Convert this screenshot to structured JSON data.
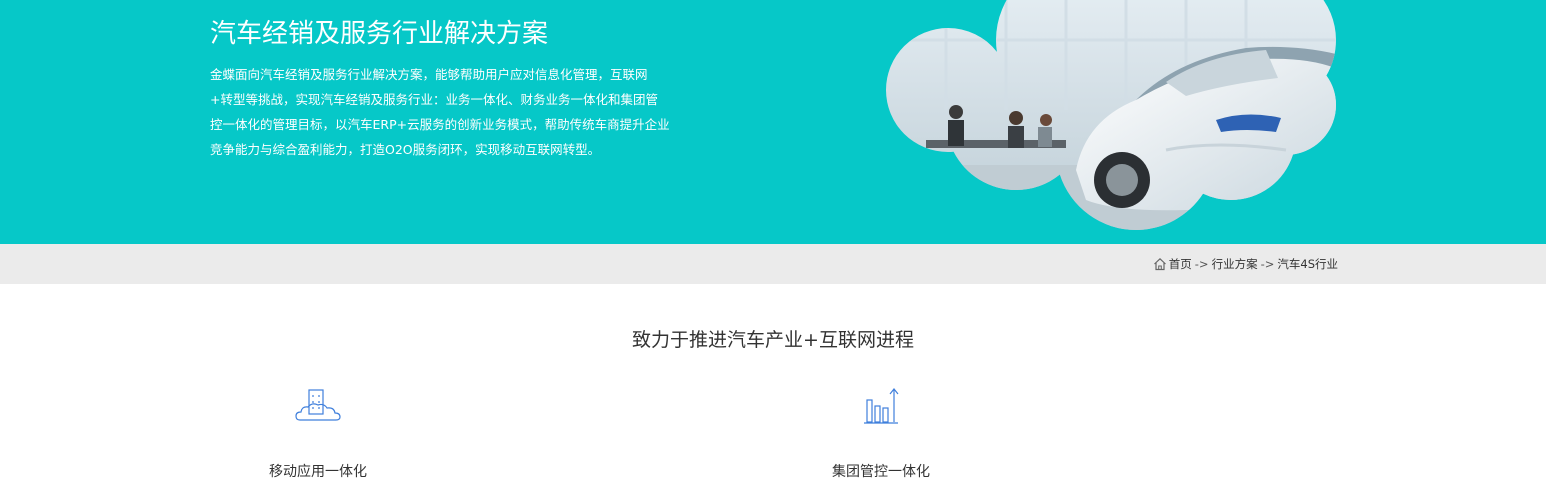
{
  "hero": {
    "title": "汽车经销及服务行业解决方案",
    "description": "金蝶面向汽车经销及服务行业解决方案，能够帮助用户应对信息化管理，互联网+转型等挑战，实现汽车经销及服务行业：业务一体化、财务业务一体化和集团管控一体化的管理目标，以汽车ERP+云服务的创新业务模式，帮助传统车商提升企业竞争能力与综合盈利能力，打造O2O服务闭环，实现移动互联网转型。",
    "image_icon": "car-showroom-cloud-image"
  },
  "breadcrumb": {
    "home_icon": "home-icon",
    "home": "首页",
    "sep1": "->",
    "item1": "行业方案",
    "sep2": "->",
    "current": "汽车4S行业"
  },
  "section": {
    "title": "致力于推进汽车产业+互联网进程"
  },
  "features": [
    {
      "icon": "cloud-building-icon",
      "label": "移动应用一体化"
    },
    {
      "icon": "bar-chart-growth-icon",
      "label": "集团管控一体化"
    }
  ],
  "colors": {
    "hero_bg": "#06c8c8",
    "breadcrumb_bg": "#ebebeb",
    "icon_blue": "#3f7fdc"
  }
}
